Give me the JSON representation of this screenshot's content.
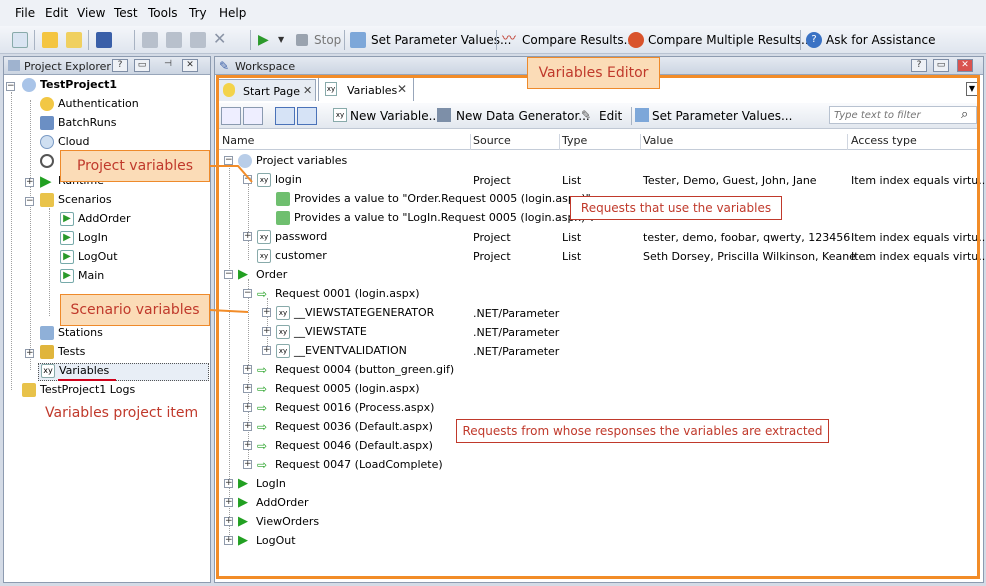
{
  "menu": [
    "File",
    "Edit",
    "View",
    "Test",
    "Tools",
    "Try",
    "Help"
  ],
  "toolbar": {
    "stop": "Stop",
    "set_params": "Set Parameter Values...",
    "compare": "Compare Results...",
    "compare_multi": "Compare Multiple Results...",
    "assist": "Ask for Assistance"
  },
  "explorer": {
    "title": "Project Explorer",
    "root": "TestProject1",
    "items": [
      "Authentication",
      "BatchRuns",
      "Cloud",
      "Runtime",
      "Scenarios",
      "AddOrder",
      "LogIn",
      "LogOut",
      "Main",
      "Stations",
      "Tests",
      "Variables"
    ],
    "logs": "TestProject1 Logs"
  },
  "workspace": {
    "title": "Workspace",
    "tabs": [
      "Start Page",
      "Variables"
    ],
    "tab_close": "X"
  },
  "editor_toolbar": {
    "new_variable": "New Variable...",
    "new_generator": "New Data Generator...",
    "edit": "Edit",
    "set_params": "Set Parameter Values...",
    "filter_placeholder": "Type text to filter"
  },
  "columns": [
    "Name",
    "Source",
    "Type",
    "Value",
    "Access type"
  ],
  "rows": [
    {
      "name": "Project variables",
      "source": "",
      "type": "",
      "value": "",
      "access": ""
    },
    {
      "name": "login",
      "source": "Project",
      "type": "List",
      "value": "Tester, Demo, Guest, John, Jane",
      "access": "Item index equals virtu..."
    },
    {
      "name": "Provides a value to \"Order.Request 0005 (login.aspx)\".",
      "source": "",
      "type": "",
      "value": "",
      "access": ""
    },
    {
      "name": "Provides a value to \"LogIn.Request 0005 (login.aspx)\".",
      "source": "",
      "type": "",
      "value": "",
      "access": ""
    },
    {
      "name": "password",
      "source": "Project",
      "type": "List",
      "value": "tester, demo, foobar, qwerty, 123456",
      "access": "Item index equals virtu..."
    },
    {
      "name": "customer",
      "source": "Project",
      "type": "List",
      "value": "Seth Dorsey, Priscilla Wilkinson, Keane ...",
      "access": "Item index equals virtu..."
    },
    {
      "name": "Order",
      "source": "",
      "type": "",
      "value": "",
      "access": ""
    },
    {
      "name": "Request 0001 (login.aspx)",
      "source": "",
      "type": "",
      "value": "",
      "access": ""
    },
    {
      "name": "__VIEWSTATEGENERATOR",
      "source": ".NET/Parameter",
      "type": "",
      "value": "",
      "access": ""
    },
    {
      "name": "__VIEWSTATE",
      "source": ".NET/Parameter",
      "type": "",
      "value": "",
      "access": ""
    },
    {
      "name": "__EVENTVALIDATION",
      "source": ".NET/Parameter",
      "type": "",
      "value": "",
      "access": ""
    },
    {
      "name": "Request 0004 (button_green.gif)",
      "source": "",
      "type": "",
      "value": "",
      "access": ""
    },
    {
      "name": "Request 0005 (login.aspx)",
      "source": "",
      "type": "",
      "value": "",
      "access": ""
    },
    {
      "name": "Request 0016 (Process.aspx)",
      "source": "",
      "type": "",
      "value": "",
      "access": ""
    },
    {
      "name": "Request 0036 (Default.aspx)",
      "source": "",
      "type": "",
      "value": "",
      "access": ""
    },
    {
      "name": "Request 0046 (Default.aspx)",
      "source": "",
      "type": "",
      "value": "",
      "access": ""
    },
    {
      "name": "Request 0047 (LoadComplete)",
      "source": "",
      "type": "",
      "value": "",
      "access": ""
    },
    {
      "name": "LogIn",
      "source": "",
      "type": "",
      "value": "",
      "access": ""
    },
    {
      "name": "AddOrder",
      "source": "",
      "type": "",
      "value": "",
      "access": ""
    },
    {
      "name": "ViewOrders",
      "source": "",
      "type": "",
      "value": "",
      "access": ""
    },
    {
      "name": "LogOut",
      "source": "",
      "type": "",
      "value": "",
      "access": ""
    }
  ],
  "callouts": {
    "editor": "Variables Editor",
    "project_vars": "Project variables",
    "scenario_vars": "Scenario variables",
    "requests_use": "Requests that use the variables",
    "requests_extract": "Requests from whose responses the variables are extracted",
    "project_item": "Variables project item"
  }
}
